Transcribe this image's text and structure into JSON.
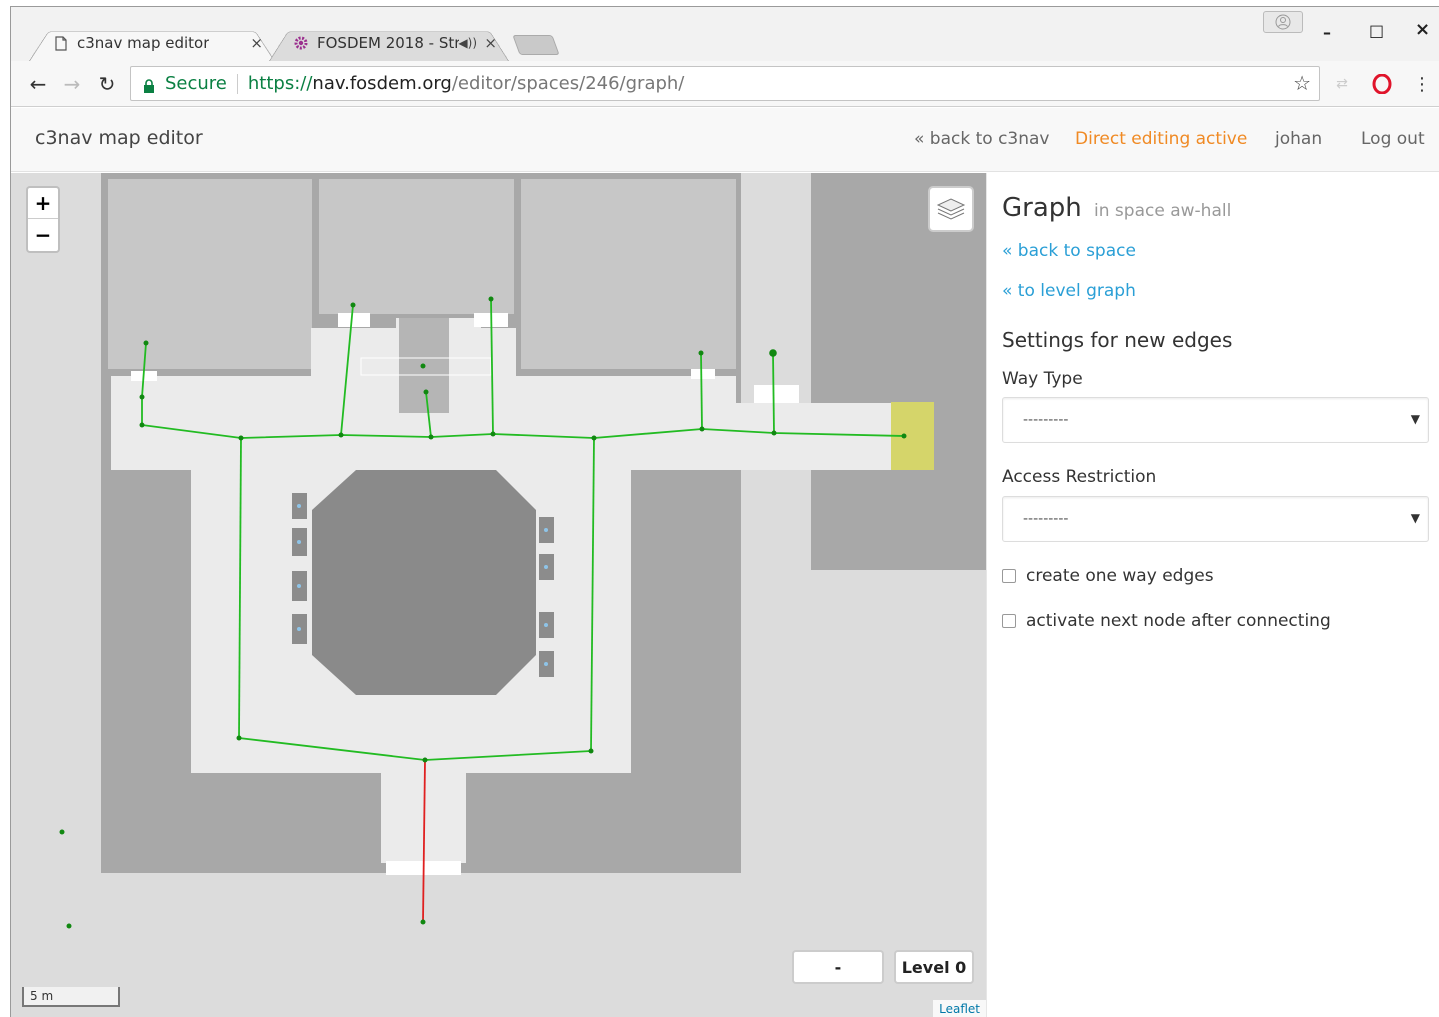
{
  "browser": {
    "tabs": [
      {
        "title": "c3nav map editor",
        "icon": "document-icon",
        "close": "×"
      },
      {
        "title": "FOSDEM 2018 - Str",
        "icon": "fosdem-gear-icon",
        "close": "×"
      }
    ],
    "secure_label": "Secure",
    "url_scheme": "https://",
    "url_host": "nav.fosdem.org",
    "url_path": "/editor/spaces/246/graph/",
    "controls": {
      "minimize": "–",
      "maximize": "□",
      "close": "×"
    }
  },
  "app": {
    "brand": "c3nav map editor",
    "nav": {
      "back": "« back to c3nav",
      "direct_editing": "Direct editing active",
      "user": "johan",
      "logout": "Log out"
    }
  },
  "map": {
    "zoom_in": "+",
    "zoom_out": "−",
    "level_dash": "-",
    "level_label": "Level 0",
    "scale_label": "5 m",
    "attribution": "Leaflet",
    "colors": {
      "edge": "#22bb22",
      "edge_active": "#e02020",
      "node": "#118811",
      "highlight": "#d5d56a"
    }
  },
  "sidebar": {
    "title": "Graph",
    "subtitle": "in space aw-hall",
    "back_to_space": "« back to space",
    "to_level_graph": "« to level graph",
    "section_title": "Settings for new edges",
    "way_type_label": "Way Type",
    "way_type_value": "---------",
    "access_label": "Access Restriction",
    "access_value": "---------",
    "checkbox_one_way": "create one way edges",
    "checkbox_activate_next": "activate next node after connecting"
  }
}
